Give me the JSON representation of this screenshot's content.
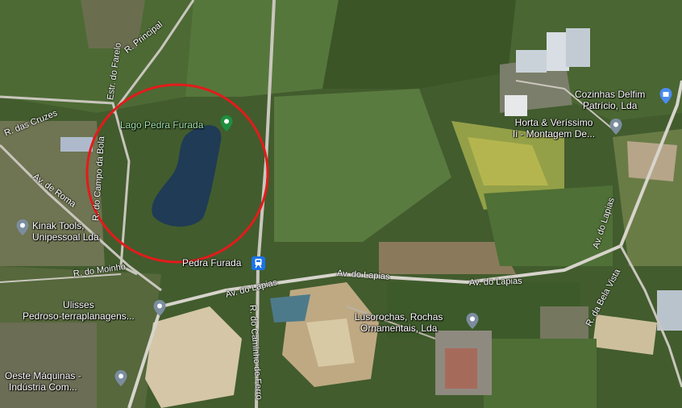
{
  "map": {
    "type": "satellite",
    "colors": {
      "highlight_circle": "#e31b1b",
      "lake": "#1f3b55",
      "road": "#c9c6bd",
      "quarry": "#d2c3a4"
    },
    "lake_label": "Lago Pedra Furada",
    "station_label": "Pedra Furada",
    "places": [
      {
        "name": "Cozinhas Delfim\nPatrício, Lda",
        "icon": "shopping-bag-icon"
      },
      {
        "name": "Horta & Veríssimo\nIi - Montagem De...",
        "icon": "pin-icon"
      },
      {
        "name": "Kinak Tools,\nUnipessoal Lda",
        "icon": "pin-icon"
      },
      {
        "name": "Ulisses\nPedroso-terraplanagens...",
        "icon": "pin-icon"
      },
      {
        "name": "Lusorochas, Rochas\nOrnamentais, Lda",
        "icon": "pin-icon"
      },
      {
        "name": "Oeste Máquinas -\nIndústria Com...",
        "icon": "pin-icon"
      }
    ],
    "roads": [
      "R. Principal",
      "Estr. do Farelo",
      "R. das Cruzes",
      "Av. de Roma",
      "R. do Campo da Bola",
      "R. do Moinho",
      "Av. do Lapias",
      "Av. do Lapias",
      "Av. do Lapias",
      "Av. do Lapias",
      "R. do Caminho de Ferro",
      "R. da Bela Vista"
    ]
  }
}
